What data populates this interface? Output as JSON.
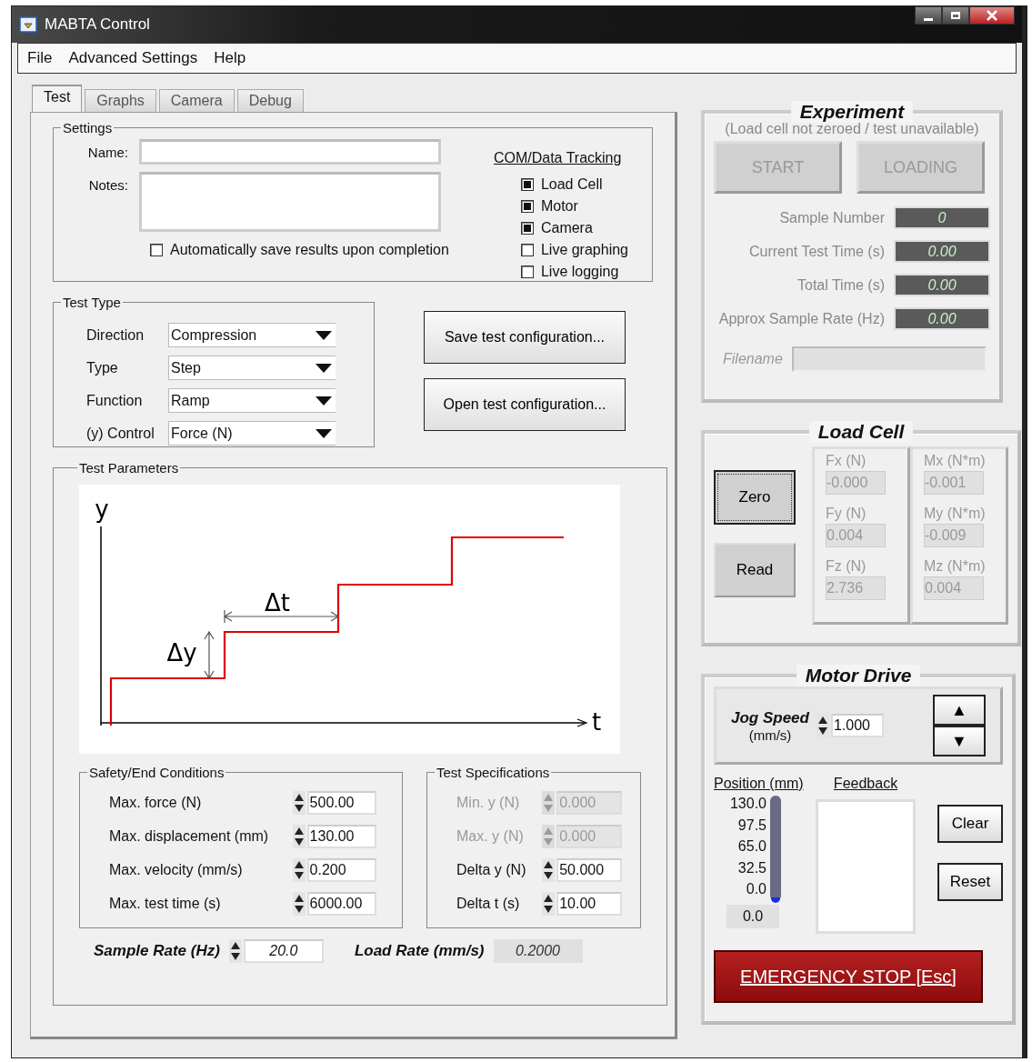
{
  "window": {
    "title": "MABTA Control"
  },
  "menu": [
    {
      "label": "File"
    },
    {
      "label": "Advanced Settings"
    },
    {
      "label": "Help"
    }
  ],
  "tabs": [
    {
      "label": "Test",
      "selected": true
    },
    {
      "label": "Graphs",
      "selected": false
    },
    {
      "label": "Camera",
      "selected": false
    },
    {
      "label": "Debug",
      "selected": false
    }
  ],
  "settings": {
    "title": "Settings",
    "fields": [
      {
        "label": "Name:",
        "kind": "line"
      },
      {
        "label": "Notes:",
        "kind": "area"
      }
    ],
    "autosave": {
      "label": "Automatically save results upon completion",
      "checked": false
    },
    "tracking": {
      "title": "COM/Data Tracking",
      "items": [
        {
          "label": "Load Cell",
          "checked": true
        },
        {
          "label": "Motor",
          "checked": true
        },
        {
          "label": "Camera",
          "checked": true
        },
        {
          "label": "Live graphing",
          "checked": false
        },
        {
          "label": "Live logging",
          "checked": false
        }
      ]
    }
  },
  "test_type": {
    "title": "Test Type",
    "rows": [
      {
        "label": "Direction",
        "value": "Compression"
      },
      {
        "label": "Type",
        "value": "Step"
      },
      {
        "label": "Function",
        "value": "Ramp"
      },
      {
        "label": "(y) Control",
        "value": "Force (N)"
      }
    ]
  },
  "config_buttons": [
    {
      "label": "Save test configuration..."
    },
    {
      "label": "Open test configuration..."
    }
  ],
  "test_parameters": {
    "title": "Test Parameters",
    "diagram": {
      "y_axis": "y",
      "x_axis": "t",
      "step_width": "Δt",
      "step_height": "Δy"
    },
    "safety": {
      "title": "Safety/End Conditions",
      "rows": [
        {
          "label": "Max. force (N)",
          "value": "500.00",
          "disabled": false
        },
        {
          "label": "Max. displacement (mm)",
          "value": "130.00",
          "disabled": false
        },
        {
          "label": "Max. velocity (mm/s)",
          "value": "0.200",
          "disabled": false
        },
        {
          "label": "Max. test time (s)",
          "value": "6000.00",
          "disabled": false
        }
      ]
    },
    "specs": {
      "title": "Test Specifications",
      "rows": [
        {
          "label": "Min. y (N)",
          "value": "0.000",
          "disabled": true
        },
        {
          "label": "Max. y (N)",
          "value": "0.000",
          "disabled": true
        },
        {
          "label": "Delta y (N)",
          "value": "50.000",
          "disabled": false
        },
        {
          "label": "Delta t (s)",
          "value": "10.00",
          "disabled": false
        }
      ]
    },
    "sample_rate": {
      "label": "Sample Rate (Hz)",
      "value": "20.0"
    },
    "load_rate": {
      "label": "Load Rate (mm/s)",
      "value": "0.2000"
    }
  },
  "experiment": {
    "title": "Experiment",
    "status": "(Load cell not zeroed / test unavailable)",
    "buttons": [
      {
        "label": "START",
        "disabled": true
      },
      {
        "label": "LOADING",
        "disabled": true
      }
    ],
    "readouts": [
      {
        "label": "Sample Number",
        "value": "0"
      },
      {
        "label": "Current Test Time (s)",
        "value": "0.00"
      },
      {
        "label": "Total Time (s)",
        "value": "0.00"
      },
      {
        "label": "Approx Sample Rate (Hz)",
        "value": "0.00"
      }
    ],
    "filename": {
      "label": "Filename"
    }
  },
  "load_cell": {
    "title": "Load Cell",
    "buttons": [
      {
        "label": "Zero",
        "focused": true
      },
      {
        "label": "Read",
        "focused": false
      }
    ],
    "columns": [
      [
        {
          "label": "Fx (N)",
          "value": "-0.000"
        },
        {
          "label": "Fy (N)",
          "value": "0.004"
        },
        {
          "label": "Fz (N)",
          "value": "2.736"
        }
      ],
      [
        {
          "label": "Mx (N*m)",
          "value": "-0.001"
        },
        {
          "label": "My (N*m)",
          "value": "-0.009"
        },
        {
          "label": "Mz (N*m)",
          "value": "0.004"
        }
      ]
    ]
  },
  "motor_drive": {
    "title": "Motor Drive",
    "jog": {
      "label": "Jog Speed",
      "unit": "(mm/s)",
      "value": "1.000",
      "up": "▲",
      "down": "▼"
    },
    "position": {
      "title": "Position (mm)",
      "scale": [
        "130.0",
        "97.5",
        "65.0",
        "32.5",
        "0.0"
      ],
      "level": 0,
      "reading": "0.0"
    },
    "feedback": {
      "title": "Feedback"
    },
    "buttons": [
      {
        "label": "Clear"
      },
      {
        "label": "Reset"
      }
    ],
    "emergency": {
      "label": "EMERGENCY STOP [Esc]"
    }
  }
}
